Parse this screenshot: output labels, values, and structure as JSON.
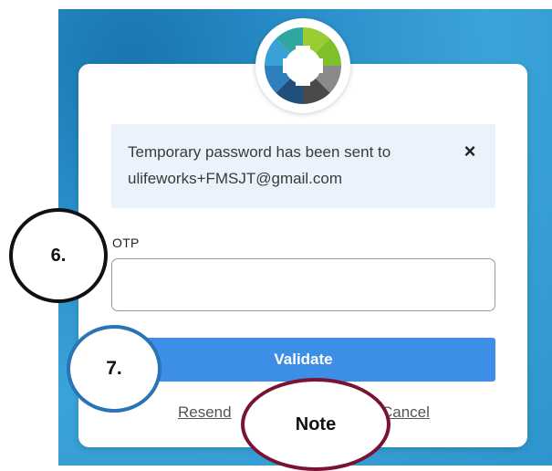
{
  "alert": {
    "message_line1": "Temporary password has been sent to",
    "message_line2": "ulifeworks+FMSJT@gmail.com",
    "close_symbol": "×"
  },
  "form": {
    "otp_label": "OTP",
    "otp_value": "",
    "validate_label": "Validate",
    "resend_label": "Resend",
    "cancel_label": "Cancel"
  },
  "annotations": {
    "step6": "6.",
    "step7": "7.",
    "note": "Note"
  },
  "colors": {
    "primary_button": "#3d8ee6",
    "alert_background": "#eaf3fc",
    "background_blue": "#2e95cd",
    "callout6_border": "#111111",
    "callout7_border": "#2a74b5",
    "note_border": "#7a1236"
  },
  "icons": {
    "logo": "medical-cross-logo-icon",
    "alert_close": "close-icon"
  }
}
